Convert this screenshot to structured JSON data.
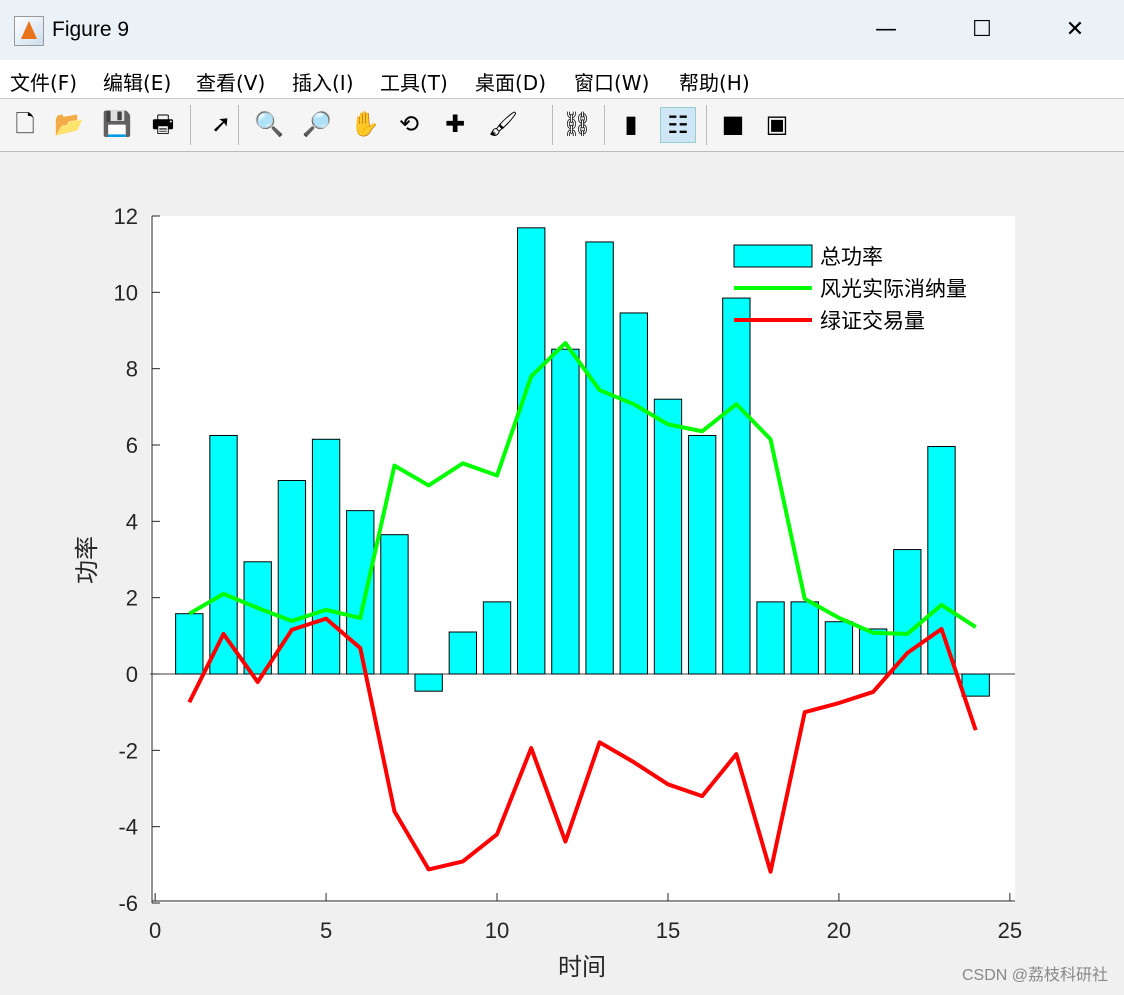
{
  "window": {
    "title": "Figure 9",
    "minimize": "—",
    "maximize": "☐",
    "close": "✕"
  },
  "menu": [
    "文件(F)",
    "编辑(E)",
    "查看(V)",
    "插入(I)",
    "工具(T)",
    "桌面(D)",
    "窗口(W)",
    "帮助(H)"
  ],
  "toolbar": [
    {
      "name": "new-figure-icon",
      "glyph": "🗋"
    },
    {
      "name": "open-icon",
      "glyph": "📂"
    },
    {
      "name": "save-icon",
      "glyph": "💾"
    },
    {
      "name": "print-icon",
      "glyph": "🖶"
    },
    {
      "name": "select-arrow-icon",
      "glyph": "➚"
    },
    {
      "name": "zoom-in-icon",
      "glyph": "🔍"
    },
    {
      "name": "zoom-out-icon",
      "glyph": "🔎"
    },
    {
      "name": "pan-hand-icon",
      "glyph": "✋"
    },
    {
      "name": "rotate-3d-icon",
      "glyph": "⟲"
    },
    {
      "name": "data-cursor-icon",
      "glyph": "✚"
    },
    {
      "name": "brush-icon",
      "glyph": "🖌"
    },
    {
      "name": "link-plot-icon",
      "glyph": "⛓"
    },
    {
      "name": "colorbar-icon",
      "glyph": "▮"
    },
    {
      "name": "legend-icon",
      "glyph": "☷"
    },
    {
      "name": "hide-plot-tools-icon",
      "glyph": "■"
    },
    {
      "name": "show-plot-tools-icon",
      "glyph": "▣"
    }
  ],
  "watermark": "CSDN @荔枝科研社",
  "chart_data": {
    "type": "bar+line",
    "xlabel": "时间",
    "ylabel": "功率",
    "xlim": [
      -0.15,
      25.15
    ],
    "ylim": [
      -6,
      12
    ],
    "xticks": [
      0,
      5,
      10,
      15,
      20,
      25
    ],
    "yticks": [
      -6,
      -4,
      -2,
      0,
      2,
      4,
      6,
      8,
      10,
      12
    ],
    "x": [
      1,
      2,
      3,
      4,
      5,
      6,
      7,
      8,
      9,
      10,
      11,
      12,
      13,
      14,
      15,
      16,
      17,
      18,
      19,
      20,
      21,
      22,
      23,
      24
    ],
    "legend_position": "top-right",
    "series": [
      {
        "name": "总功率",
        "type": "bar",
        "color": "#00ffff",
        "values": [
          1.58,
          6.25,
          2.94,
          5.07,
          6.15,
          4.28,
          3.65,
          -0.45,
          1.1,
          1.89,
          11.69,
          8.51,
          11.32,
          9.46,
          7.2,
          6.25,
          9.85,
          1.89,
          1.89,
          1.37,
          1.18,
          3.26,
          5.96,
          -0.58
        ]
      },
      {
        "name": "风光实际消纳量",
        "type": "line",
        "color": "#00ff00",
        "values": [
          1.58,
          2.1,
          1.73,
          1.39,
          1.68,
          1.47,
          5.46,
          4.94,
          5.52,
          5.2,
          7.8,
          8.67,
          7.44,
          7.07,
          6.54,
          6.36,
          7.07,
          6.15,
          1.97,
          1.47,
          1.08,
          1.05,
          1.81,
          1.23
        ]
      },
      {
        "name": "绿证交易量",
        "type": "line",
        "color": "#ff0000",
        "values": [
          -0.74,
          1.05,
          -0.21,
          1.16,
          1.45,
          0.68,
          -3.6,
          -5.12,
          -4.91,
          -4.2,
          -1.94,
          -4.39,
          -1.79,
          -2.31,
          -2.89,
          -3.2,
          -2.1,
          -5.18,
          -1.0,
          -0.76,
          -0.47,
          0.55,
          1.18,
          -1.47
        ]
      }
    ]
  }
}
